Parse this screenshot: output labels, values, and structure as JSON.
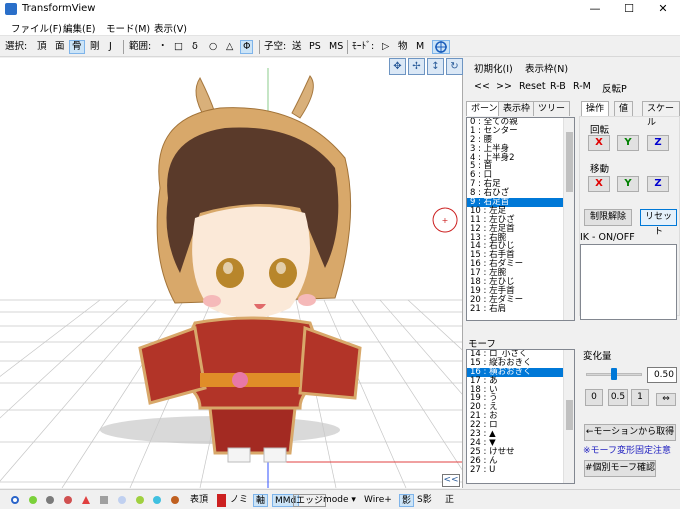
{
  "window": {
    "title": "TransformView",
    "minimize": "—",
    "maximize": "☐",
    "close": "✕"
  },
  "menu": [
    "ファイル(F)",
    "編集(E)",
    "モード(M)",
    "表示(V)"
  ],
  "toolbar": {
    "select_label": "選択:",
    "select_items": [
      "頂",
      "面",
      "骨",
      "剛",
      "J"
    ],
    "range_label": "範囲:",
    "range_items": [
      "・",
      "□",
      "δ",
      "○",
      "△",
      "Φ"
    ],
    "child_label": "子空:",
    "child_items": [
      "送",
      "PS",
      "MS"
    ],
    "mode_label": "ﾓｰﾄﾞ:",
    "mode_items": [
      "▷",
      "物",
      "M"
    ]
  },
  "panel": {
    "init_label": "初期化(I)",
    "display_frame_label": "表示枠(N)",
    "prev": "<<",
    "next": ">>",
    "reset": "Reset",
    "rb": "R-B",
    "rm": "R-M",
    "flip": "反転P",
    "bone_tabs": [
      "ボーン",
      "表示枠",
      "ツリー"
    ],
    "bones": [
      "0 : 全ての親",
      "1 : センター",
      "2 : 腰",
      "3 : 上半身",
      "4 : 上半身2",
      "5 : 首",
      "6 : 口",
      "7 : 右足",
      "8 : 右ひざ",
      "9 : 右足首",
      "10 : 左足",
      "11 : 左ひざ",
      "12 : 左足首",
      "13 : 右腕",
      "14 : 右ひじ",
      "15 : 右手首",
      "16 : 右ダミー",
      "17 : 左腕",
      "18 : 左ひじ",
      "19 : 左手首",
      "20 : 左ダミー",
      "21 : 右肩"
    ],
    "bones_selected": 9,
    "op_tabs": [
      "操作",
      "値",
      "スケール"
    ],
    "rotate_label": "回転",
    "move_label": "移動",
    "axes": [
      "X",
      "Y",
      "Z"
    ],
    "limit_release": "制限解除",
    "reset_button": "リセット",
    "ik_label": "IK - ON/OFF",
    "morph_label": "モーフ",
    "morphs": [
      "14 : ロ_小さく",
      "15 : 縦おおきく",
      "16 : 横おおきく",
      "17 : あ",
      "18 : い",
      "19 : う",
      "20 : え",
      "21 : お",
      "22 : ロ",
      "23 : ▲",
      "24 : ▼",
      "25 : けせせ",
      "26 : ん",
      "27 : U"
    ],
    "morphs_selected": 2,
    "change_label": "変化量",
    "change_value": "0.50",
    "val0": "0",
    "val05": "0.5",
    "val1": "1",
    "from_motion": "←モーションから取得",
    "fixed_note": "※モーフ変形固定注意",
    "individual_morph": "#個別モーフ確認",
    "collapse": "<<"
  },
  "statusbar": {
    "items": [
      "表頂",
      "ノミ",
      "軸",
      "MMd",
      "エッジ",
      "mode ▾",
      "Wire+",
      "影",
      "S影",
      "正"
    ],
    "dot_colors": [
      "#2a64c9",
      "#7bd13a",
      "#e04040",
      "#7a7a7a",
      "#40c0e0",
      "#a0d040",
      "#c06020"
    ]
  }
}
